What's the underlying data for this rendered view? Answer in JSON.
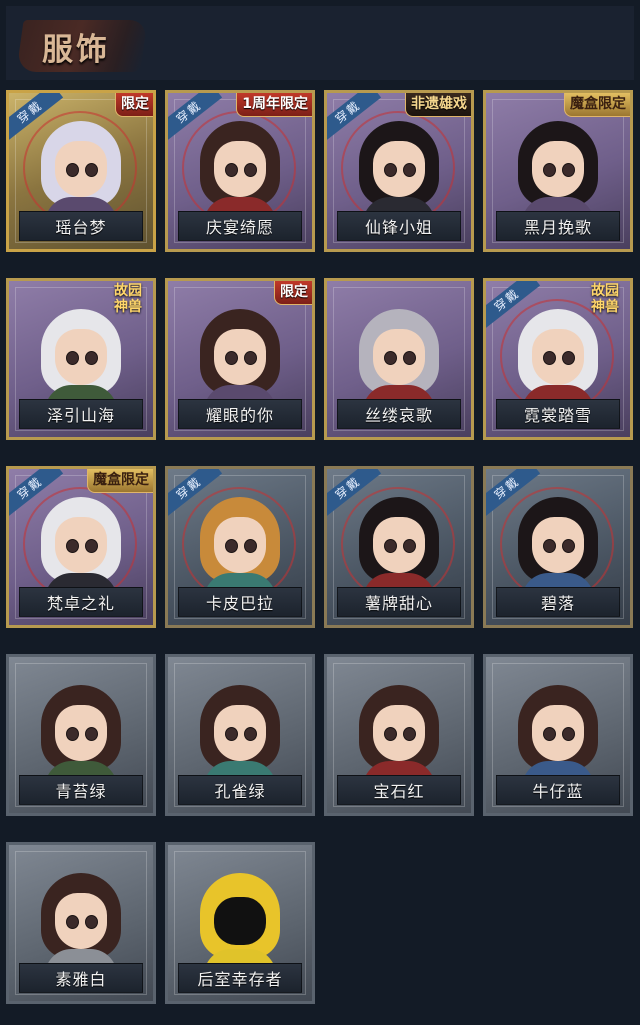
{
  "header": {
    "title": "服饰"
  },
  "tags": {
    "wear": "穿戴"
  },
  "costumes": [
    {
      "name": "瑶台梦",
      "badge": "限定",
      "badge_style": "red",
      "worn": true,
      "tier": "legendary",
      "hair": "hair-w",
      "body": "body-purple"
    },
    {
      "name": "庆宴绮愿",
      "badge": "1周年限定",
      "badge_style": "red",
      "worn": true,
      "tier": "exotic",
      "hair": "hair-b",
      "body": "body-red"
    },
    {
      "name": "仙锋小姐",
      "badge": "非遗雄戏",
      "badge_style": "dark",
      "worn": true,
      "tier": "exotic",
      "hair": "hair-k",
      "body": "body-dark"
    },
    {
      "name": "黑月挽歌",
      "badge": "魔盒限定",
      "badge_style": "gold",
      "worn": false,
      "tier": "exotic",
      "hair": "hair-k",
      "body": "body-purple"
    },
    {
      "name": "泽引山海",
      "badge": "故园神兽",
      "badge_style": "seal",
      "worn": false,
      "tier": "exotic",
      "hair": "hair-g",
      "body": "body-green"
    },
    {
      "name": "耀眼的你",
      "badge": "限定",
      "badge_style": "red",
      "worn": false,
      "tier": "exotic",
      "hair": "hair-b",
      "body": "body-purple"
    },
    {
      "name": "丝缕哀歌",
      "badge": "",
      "badge_style": "",
      "worn": false,
      "tier": "exotic",
      "hair": "hair-s",
      "body": "body-red"
    },
    {
      "name": "霓裳踏雪",
      "badge": "故园神兽",
      "badge_style": "seal",
      "worn": true,
      "tier": "exotic",
      "hair": "hair-g",
      "body": "body-red"
    },
    {
      "name": "梵卓之礼",
      "badge": "魔盒限定",
      "badge_style": "gold",
      "worn": true,
      "tier": "exotic",
      "hair": "hair-g",
      "body": "body-dark"
    },
    {
      "name": "卡皮巴拉",
      "badge": "",
      "badge_style": "",
      "worn": true,
      "tier": "rare",
      "hair": "hair-o",
      "body": "body-teal"
    },
    {
      "name": "薯牌甜心",
      "badge": "",
      "badge_style": "",
      "worn": true,
      "tier": "rare",
      "hair": "hair-k",
      "body": "body-red"
    },
    {
      "name": "碧落",
      "badge": "",
      "badge_style": "",
      "worn": true,
      "tier": "rare",
      "hair": "hair-k",
      "body": "body-blue"
    },
    {
      "name": "青苔绿",
      "badge": "",
      "badge_style": "",
      "worn": false,
      "tier": "normal",
      "hair": "hair-b",
      "body": "body-green"
    },
    {
      "name": "孔雀绿",
      "badge": "",
      "badge_style": "",
      "worn": false,
      "tier": "normal",
      "hair": "hair-b",
      "body": "body-teal"
    },
    {
      "name": "宝石红",
      "badge": "",
      "badge_style": "",
      "worn": false,
      "tier": "normal",
      "hair": "hair-b",
      "body": "body-red"
    },
    {
      "name": "牛仔蓝",
      "badge": "",
      "badge_style": "",
      "worn": false,
      "tier": "normal",
      "hair": "hair-b",
      "body": "body-blue"
    },
    {
      "name": "素雅白",
      "badge": "",
      "badge_style": "",
      "worn": false,
      "tier": "normal",
      "hair": "hair-b",
      "body": "body-grey"
    },
    {
      "name": "后室幸存者",
      "badge": "",
      "badge_style": "",
      "worn": false,
      "tier": "normal",
      "hair": "hair-y",
      "body": "body-yellow"
    }
  ]
}
